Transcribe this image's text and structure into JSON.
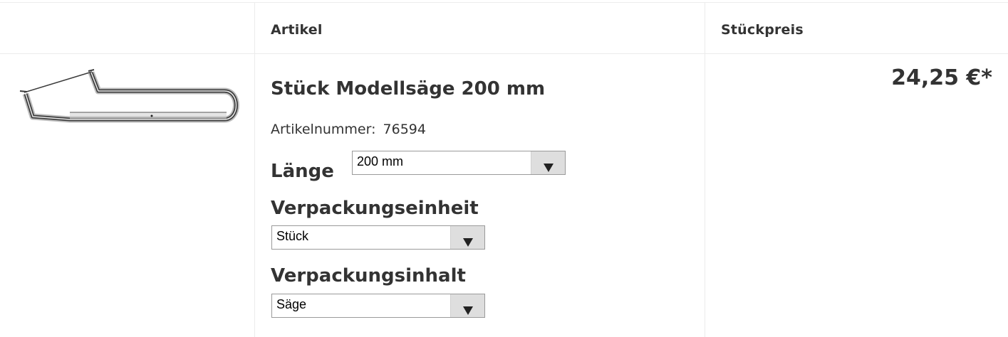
{
  "table": {
    "headers": {
      "image": "",
      "article": "Artikel",
      "unit_price": "Stückpreis"
    }
  },
  "product": {
    "title": "Stück Modellsäge 200 mm",
    "article_number_label": "Artikelnummer:",
    "article_number": "76594",
    "image_icon": "saw-icon",
    "options": {
      "length": {
        "label": "Länge",
        "selected": "200 mm"
      },
      "packaging_unit": {
        "label": "Verpackungseinheit",
        "selected": "Stück"
      },
      "packaging_content": {
        "label": "Verpackungsinhalt",
        "selected": "Säge"
      }
    },
    "price": "24,25 €*"
  }
}
